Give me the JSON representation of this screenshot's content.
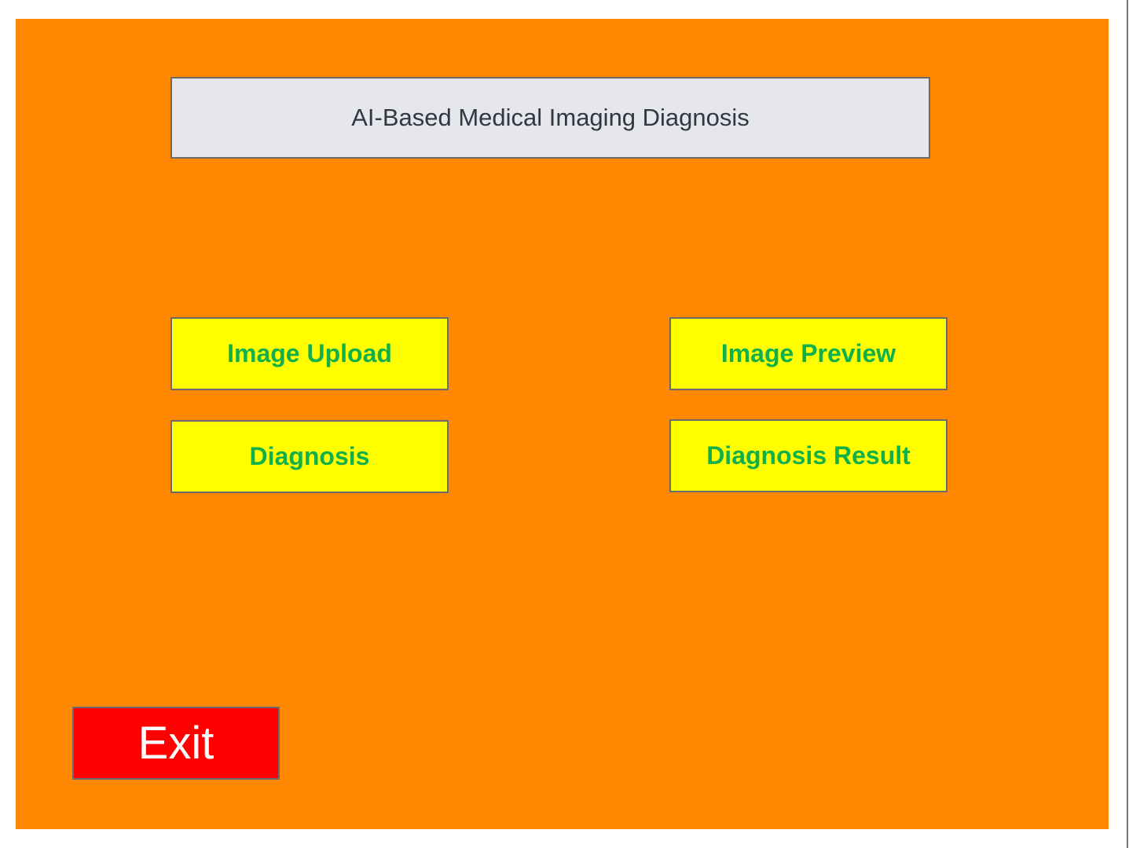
{
  "app": {
    "title": "AI-Based Medical Imaging Diagnosis"
  },
  "buttons": {
    "image_upload": "Image Upload",
    "image_preview": "Image Preview",
    "diagnosis": "Diagnosis",
    "diagnosis_result": "Diagnosis Result",
    "exit": "Exit"
  },
  "colors": {
    "background": "#ff8800",
    "title_bg": "#e6e7eb",
    "button_bg": "#ffff00",
    "button_text": "#12b04b",
    "exit_bg": "#ff0000",
    "exit_text": "#ffffff"
  }
}
